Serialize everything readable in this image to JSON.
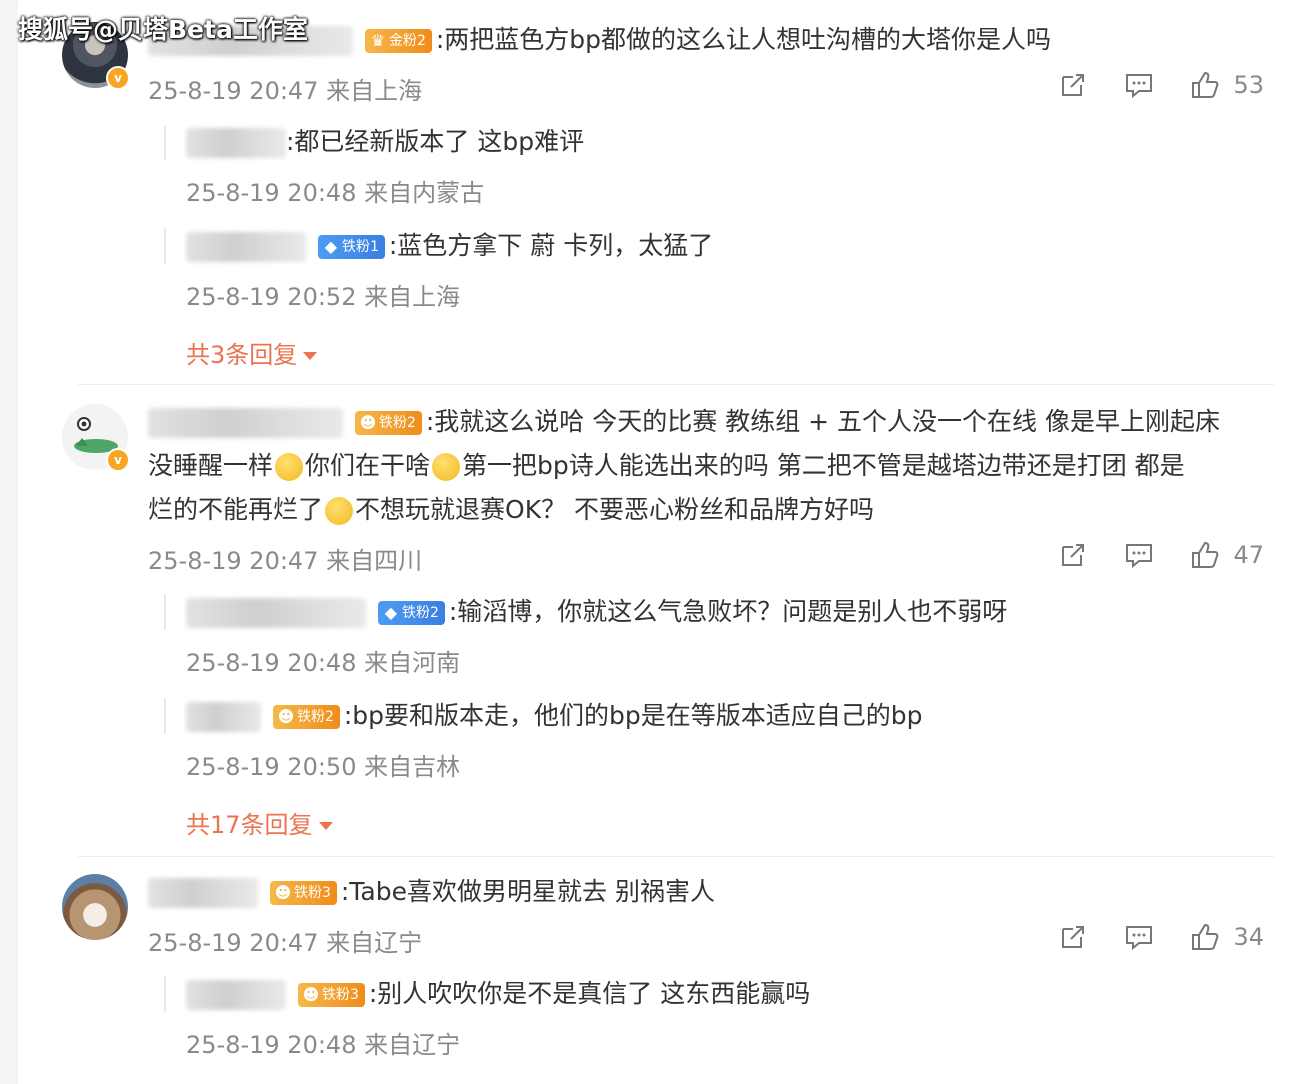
{
  "watermark": "搜狐号@贝塔Beta工作室",
  "comments": [
    {
      "badge": "金粉2",
      "text": ":两把蓝色方bp都做的这么让人想吐沟槽的大塔你是人吗",
      "meta": "25-8-19 20:47 来自上海",
      "likes": "53",
      "replies": [
        {
          "badge": "",
          "text": ":都已经新版本了  这bp难评",
          "meta": "25-8-19 20:48 来自内蒙古"
        },
        {
          "badge": "铁粉1",
          "text": ":蓝色方拿下 蔚 卡列，太猛了",
          "meta": "25-8-19 20:52 来自上海"
        }
      ],
      "more": "共3条回复"
    },
    {
      "badge": "铁粉2",
      "text_line1": ":我就这么说哈 今天的比赛 教练组 + 五个人没一个在线 像是早上刚起床",
      "text_line2a": "没睡醒一样",
      "text_line2b": "你们在干啥",
      "text_line2c": "第一把bp诗人能选出来的吗 第二把不管是越塔边带还是打团 都是",
      "text_line3a": "烂的不能再烂了",
      "text_line3b": "不想玩就退赛OK？ 不要恶心粉丝和品牌方好吗",
      "meta": "25-8-19 20:47 来自四川",
      "likes": "47",
      "replies": [
        {
          "badge": "铁粉2",
          "text": ":输滔博，你就这么气急败坏？问题是别人也不弱呀",
          "meta": "25-8-19 20:48 来自河南"
        },
        {
          "badge": "铁粉2",
          "text": ":bp要和版本走，他们的bp是在等版本适应自己的bp",
          "meta": "25-8-19 20:50 来自吉林"
        }
      ],
      "more": "共17条回复"
    },
    {
      "badge": "铁粉3",
      "text": ":Tabe喜欢做男明星就去 别祸害人",
      "meta": "25-8-19 20:47 来自辽宁",
      "likes": "34",
      "replies": [
        {
          "badge": "铁粉3",
          "text": ":别人吹吹你是不是真信了 这东西能赢吗",
          "meta": "25-8-19 20:48 来自辽宁"
        }
      ]
    }
  ],
  "icons": [
    "share-icon",
    "comment-icon",
    "like-icon",
    "verified-badge-icon"
  ],
  "colors": {
    "more_link": "#eb7350",
    "meta": "#8a8a8a",
    "gold_badge": "#f5b84a",
    "blue_badge": "#4c9cf2"
  }
}
